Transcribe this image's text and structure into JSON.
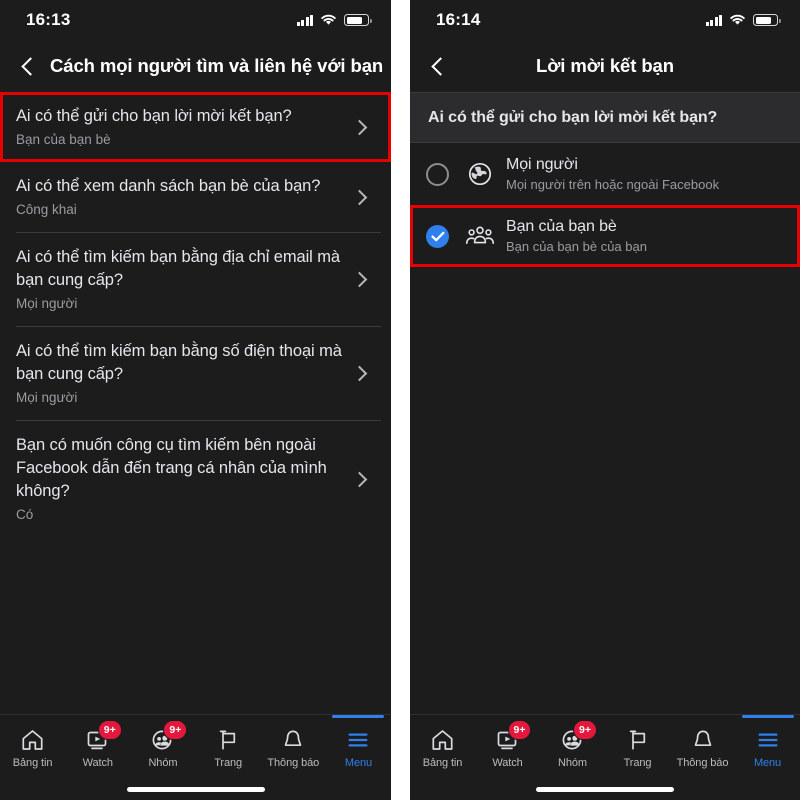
{
  "left": {
    "status": {
      "time": "16:13",
      "signal_icon": "cellular-signal-icon",
      "wifi_icon": "wifi-icon",
      "battery_icon": "battery-icon"
    },
    "nav": {
      "back_icon": "chevron-left-icon",
      "title": "Cách mọi người tìm và liên hệ với bạn"
    },
    "rows": [
      {
        "question": "Ai có thể gửi cho bạn lời mời kết bạn?",
        "answer": "Bạn của bạn bè",
        "highlighted": true
      },
      {
        "question": "Ai có thể xem danh sách bạn bè của bạn?",
        "answer": "Công khai",
        "highlighted": false
      },
      {
        "question": "Ai có thể tìm kiếm bạn bằng địa chỉ email mà bạn cung cấp?",
        "answer": "Mọi người",
        "highlighted": false
      },
      {
        "question": "Ai có thể tìm kiếm bạn bằng số điện thoại mà bạn cung cấp?",
        "answer": "Mọi người",
        "highlighted": false
      },
      {
        "question": "Bạn có muốn công cụ tìm kiếm bên ngoài Facebook dẫn đến trang cá nhân của mình không?",
        "answer": "Có",
        "highlighted": false
      }
    ]
  },
  "right": {
    "status": {
      "time": "16:14",
      "signal_icon": "cellular-signal-icon",
      "wifi_icon": "wifi-icon",
      "battery_icon": "battery-icon"
    },
    "nav": {
      "back_icon": "chevron-left-icon",
      "title": "Lời mời kết bạn"
    },
    "section_header": "Ai có thể gửi cho bạn lời mời kết bạn?",
    "options": [
      {
        "name": "Mọi người",
        "desc": "Mọi người trên hoặc ngoài Facebook",
        "icon": "globe-icon",
        "selected": false,
        "highlighted": false
      },
      {
        "name": "Bạn của bạn bè",
        "desc": "Bạn của bạn bè của bạn",
        "icon": "friends-group-icon",
        "selected": true,
        "highlighted": true
      }
    ]
  },
  "tabbar": {
    "items": [
      {
        "label": "Bảng tin",
        "icon": "home-icon",
        "badge": "",
        "active": false
      },
      {
        "label": "Watch",
        "icon": "watch-video-icon",
        "badge": "9+",
        "active": false
      },
      {
        "label": "Nhóm",
        "icon": "groups-icon",
        "badge": "9+",
        "active": false
      },
      {
        "label": "Trang",
        "icon": "pages-flag-icon",
        "badge": "",
        "active": false
      },
      {
        "label": "Thông báo",
        "icon": "bell-icon",
        "badge": "",
        "active": false
      },
      {
        "label": "Menu",
        "icon": "hamburger-menu-icon",
        "badge": "",
        "active": true
      }
    ]
  },
  "colors": {
    "background": "#1c1c1d",
    "header_row": "#2c2c2e",
    "accent_blue": "#2f80ed",
    "highlight_red": "#e60000",
    "badge_red": "#e4183c",
    "primary_text": "#e4e6eb",
    "secondary_text": "#9a9ca1"
  }
}
